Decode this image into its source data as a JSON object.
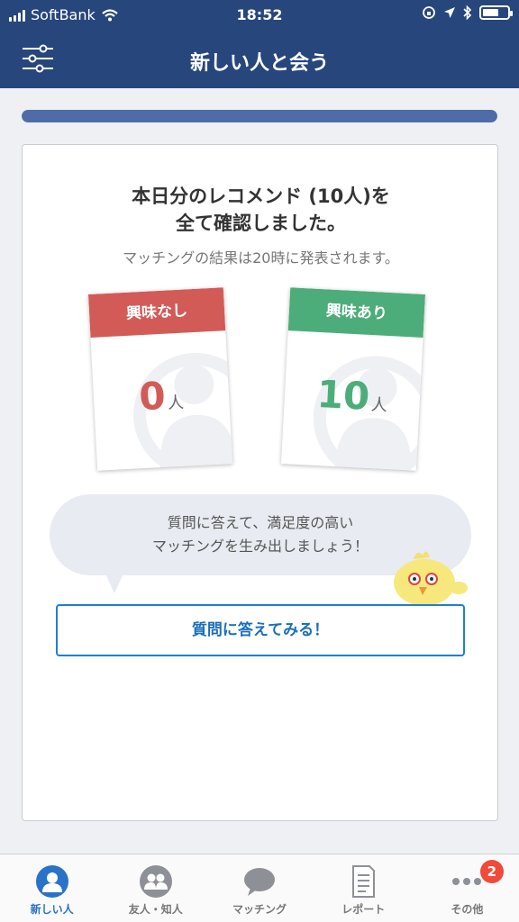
{
  "status_bar": {
    "carrier": "SoftBank",
    "time": "18:52",
    "battery_level": 0.7
  },
  "header": {
    "title": "新しい人と会う",
    "filter_icon": "sliders-icon"
  },
  "progress": {
    "value": 1.0
  },
  "recommend": {
    "headline_line1": "本日分のレコメンド (10人)を",
    "headline_line2": "全て確認しました。",
    "subtext": "マッチングの結果は20時に発表されます。",
    "not_interested": {
      "label": "興味なし",
      "count": "0",
      "unit": "人"
    },
    "interested": {
      "label": "興味あり",
      "count": "10",
      "unit": "人"
    },
    "bubble_line1": "質問に答えて、満足度の高い",
    "bubble_line2": "マッチングを生み出しましょう！",
    "answer_button": "質問に答えてみる！"
  },
  "tabs": [
    {
      "label": "新しい人",
      "icon": "person-icon",
      "active": true
    },
    {
      "label": "友人・知人",
      "icon": "people-icon"
    },
    {
      "label": "マッチング",
      "icon": "chat-bubble-icon"
    },
    {
      "label": "レポート",
      "icon": "report-icon"
    },
    {
      "label": "その他",
      "icon": "more-icon",
      "badge": "2"
    }
  ],
  "colors": {
    "header": "#27467c",
    "not_interested": "#d25b58",
    "interested": "#4dad7a",
    "accent": "#1f7fcf"
  }
}
